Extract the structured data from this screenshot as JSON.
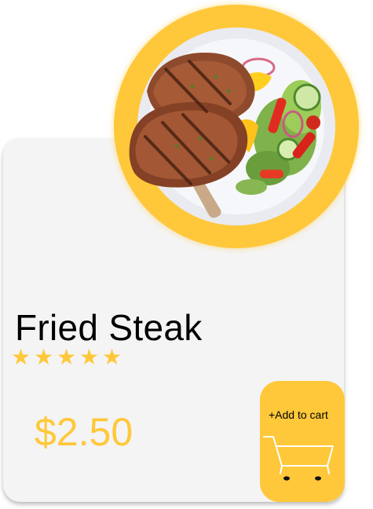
{
  "product": {
    "name": "Fried Steak",
    "rating_stars": 5,
    "star_glyph": "★",
    "price": "$2.50",
    "image_icon": "fried-steak-plate-icon"
  },
  "cart_button": {
    "label": "+Add to cart",
    "icon": "shopping-cart-icon"
  },
  "colors": {
    "accent": "#ffc83a",
    "card_background": "#f4f4f4",
    "title_text": "#000000"
  }
}
